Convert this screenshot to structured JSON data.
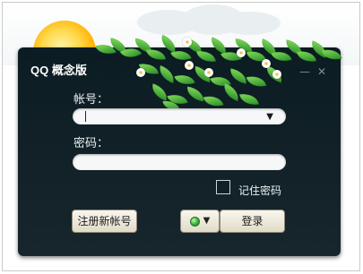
{
  "window": {
    "title": "QQ 概念版",
    "minimize_glyph": "—",
    "close_glyph": "✕"
  },
  "account": {
    "label": "帐号：",
    "value": "",
    "placeholder": ""
  },
  "password": {
    "label": "密码：",
    "value": "",
    "placeholder": ""
  },
  "remember": {
    "label": "记住密码",
    "checked": false
  },
  "buttons": {
    "register_label": "注册新帐号",
    "login_label": "登录"
  },
  "status": {
    "icon": "online-status-icon",
    "caret_glyph": "▼"
  },
  "dropdown": {
    "caret_glyph": "▼"
  },
  "colors": {
    "window_bg": "#0b1c22",
    "text": "#e9f0f3",
    "button_bg": "#eae3cf"
  }
}
